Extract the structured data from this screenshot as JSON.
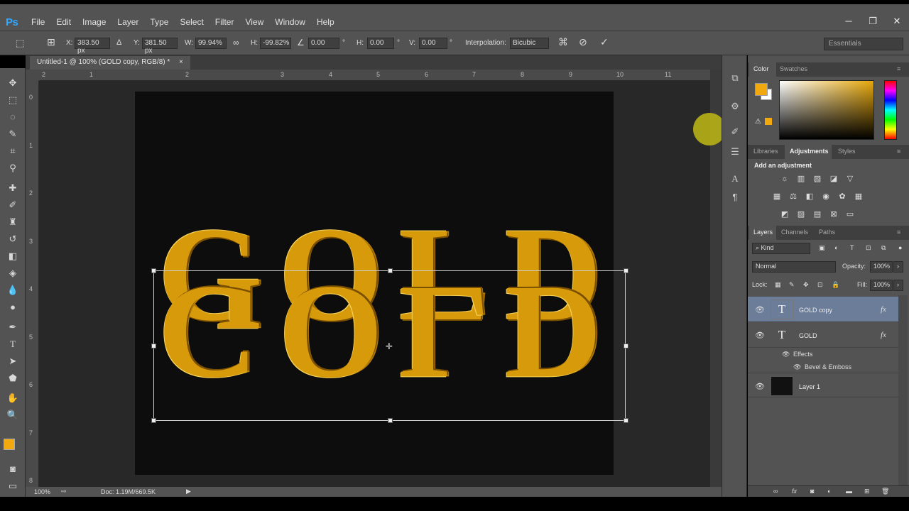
{
  "app": {
    "logo": "Ps"
  },
  "menu": [
    "File",
    "Edit",
    "Image",
    "Layer",
    "Type",
    "Select",
    "Filter",
    "View",
    "Window",
    "Help"
  ],
  "window_controls": {
    "minimize": "─",
    "restore": "❐",
    "close": "✕"
  },
  "options": {
    "x_label": "X:",
    "x_value": "383.50 px",
    "y_label": "Y:",
    "y_value": "381.50 px",
    "w_label": "W:",
    "w_value": "99.94%",
    "h_label": "H:",
    "h_value": "-99.82%",
    "angle_value": "0.00",
    "hskew_label": "H:",
    "hskew_value": "0.00",
    "vskew_label": "V:",
    "vskew_value": "0.00",
    "degree": "°",
    "interp_label": "Interpolation:",
    "interp_value": "Bicubic",
    "workspace": "Essentials"
  },
  "document": {
    "tab_title": "Untitled-1 @ 100% (GOLD copy, RGB/8) *",
    "tab_close": "×",
    "text": "GOLD",
    "zoom": "100%",
    "doc_size": "Doc: 1.19M/669.5K"
  },
  "rulers": {
    "h": [
      "2",
      "1",
      "2",
      "3",
      "4",
      "5",
      "6",
      "7",
      "8",
      "9",
      "10",
      "11"
    ],
    "v": [
      "0",
      "1",
      "2",
      "3",
      "4",
      "5",
      "6",
      "7",
      "8"
    ]
  },
  "color_panel": {
    "tabs": [
      "Color",
      "Swatches"
    ],
    "fg": "#f2a90e",
    "bg": "#ffffff"
  },
  "adjustments_panel": {
    "tabs": [
      "Libraries",
      "Adjustments",
      "Styles"
    ],
    "title": "Add an adjustment"
  },
  "layers_panel": {
    "tabs": [
      "Layers",
      "Channels",
      "Paths"
    ],
    "kind": "Kind",
    "blend": "Normal",
    "opacity_label": "Opacity:",
    "opacity_value": "100%",
    "lock_label": "Lock:",
    "fill_label": "Fill:",
    "fill_value": "100%",
    "layers": [
      {
        "name": "GOLD copy",
        "type": "T",
        "fx": "fx",
        "selected": true
      },
      {
        "name": "GOLD",
        "type": "T",
        "fx": "fx",
        "selected": false
      },
      {
        "name": "Layer 1",
        "type": "",
        "fx": "",
        "selected": false
      }
    ],
    "effects_label": "Effects",
    "effect_name": "Bevel & Emboss"
  }
}
